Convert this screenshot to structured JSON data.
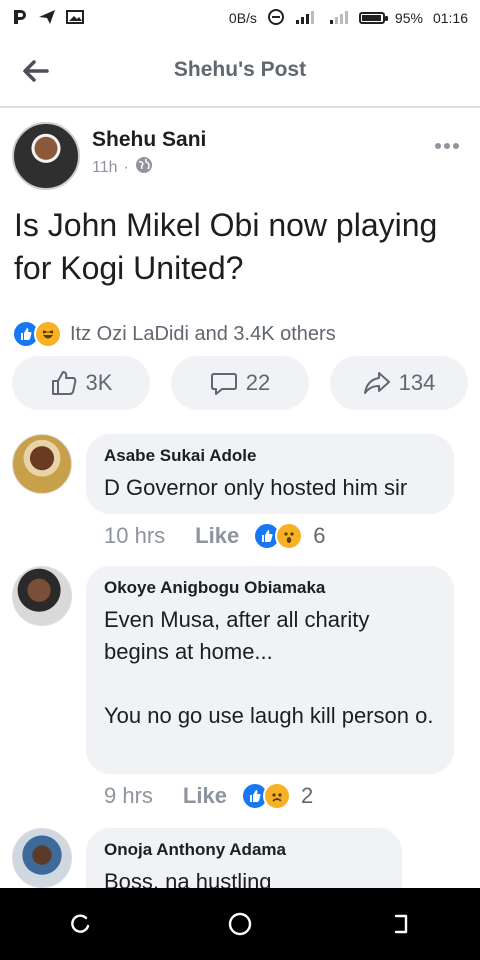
{
  "status_bar": {
    "net_speed": "0B/s",
    "battery": "95%",
    "time": "01:16",
    "battery_level": 0.95
  },
  "header": {
    "title": "Shehu's Post"
  },
  "post": {
    "author": "Shehu Sani",
    "time_ago": "11h",
    "separator": "·",
    "text": "Is John Mikel Obi now playing for Kogi United?",
    "reactions_text": "Itz Ozi LaDidi and 3.4K others",
    "likes": "3K",
    "comments": "22",
    "shares": "134"
  },
  "comments": [
    {
      "name": "Asabe Sukai Adole",
      "text": "D Governor only hosted him sir",
      "time": "10 hrs",
      "like_label": "Like",
      "reaction_count": "6"
    },
    {
      "name": "Okoye Anigbogu Obiamaka",
      "text": "Even Musa, after all charity begins at home...\n\nYou no go use laugh kill person o.",
      "time": "9 hrs",
      "like_label": "Like",
      "reaction_count": "2"
    },
    {
      "name": "Onoja Anthony Adama",
      "text": "Boss, na hustling"
    }
  ],
  "colors": {
    "accent": "#1877f2",
    "bubble": "#f0f2f5",
    "secondary_text": "#606770"
  }
}
